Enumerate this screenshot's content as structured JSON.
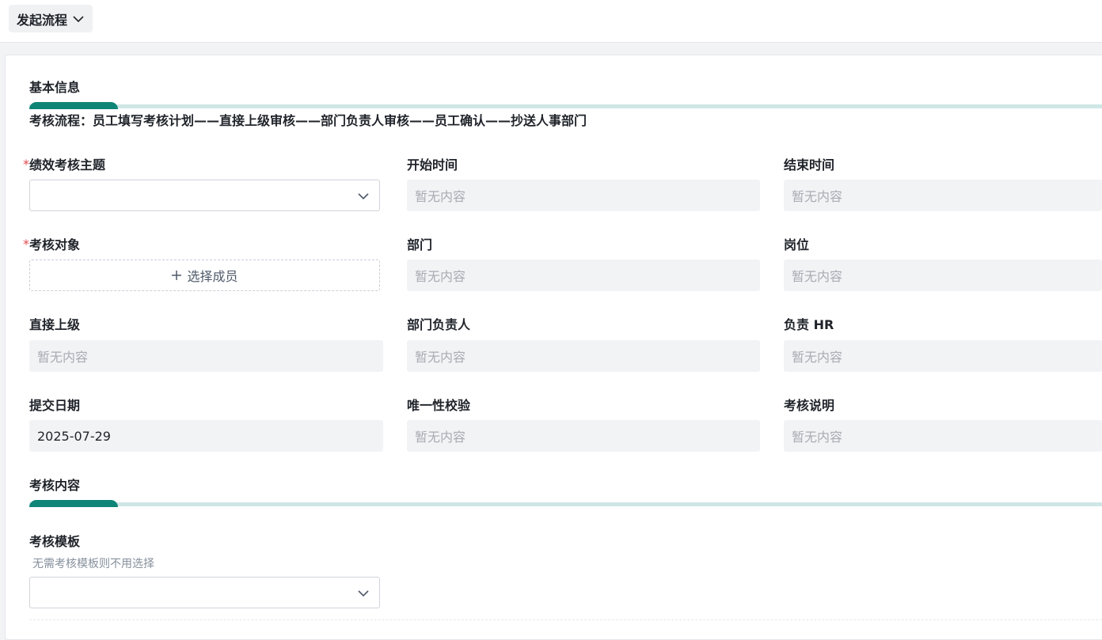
{
  "header": {
    "flow_button_label": "发起流程"
  },
  "sections": {
    "basic_info": "基本信息",
    "flow_desc": "考核流程：员工填写考核计划——直接上级审核——部门负责人审核——员工确认——抄送人事部门",
    "assessment_content": "考核内容"
  },
  "fields": {
    "theme": {
      "label": "绩效考核主题",
      "required": "*"
    },
    "start_time": {
      "label": "开始时间",
      "placeholder": "暂无内容"
    },
    "end_time": {
      "label": "结束时间",
      "placeholder": "暂无内容"
    },
    "target": {
      "label": "考核对象",
      "required": "*",
      "picker_label": "选择成员"
    },
    "department": {
      "label": "部门",
      "placeholder": "暂无内容"
    },
    "position": {
      "label": "岗位",
      "placeholder": "暂无内容"
    },
    "direct_superior": {
      "label": "直接上级",
      "placeholder": "暂无内容"
    },
    "dept_head": {
      "label": "部门负责人",
      "placeholder": "暂无内容"
    },
    "hr": {
      "label": "负责 HR",
      "placeholder": "暂无内容"
    },
    "submit_date": {
      "label": "提交日期",
      "value": "2025-07-29"
    },
    "uniqueness": {
      "label": "唯一性校验",
      "placeholder": "暂无内容"
    },
    "description": {
      "label": "考核说明",
      "placeholder": "暂无内容"
    },
    "template": {
      "label": "考核模板",
      "hint": "无需考核模板则不用选择"
    }
  },
  "icons": {
    "flow_chevron": "chevron-down-icon",
    "select_chevron": "chevron-down-icon",
    "add": "plus-icon"
  },
  "colors": {
    "accent": "#0f8577",
    "accent_track": "#cfe6e6",
    "required": "#e5484d"
  }
}
